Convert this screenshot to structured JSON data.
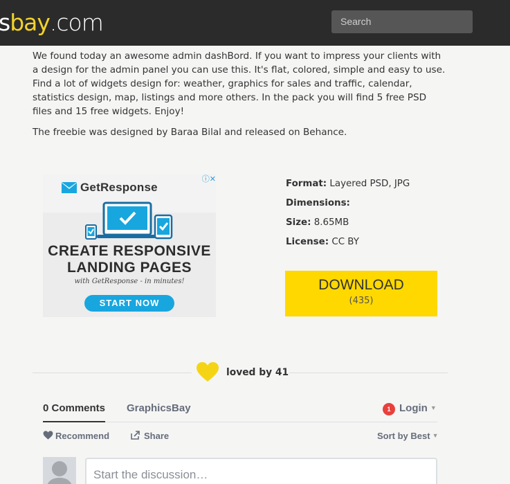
{
  "header": {
    "logo_part1": "s",
    "logo_part2": "bay",
    "logo_part3": ".com",
    "search_placeholder": "Search"
  },
  "article": {
    "paragraph1": "We found today an awesome admin dashBord. If you want to impress your clients with a design for the admin panel you can use this. It's flat, colored, simple and easy to use. Find a lot of widgets design for: weather, graphics for sales and traffic, calendar, statistics design, map, listings and more others. In the pack you will find 5 free PSD files and 15 free widgets. Enjoy!",
    "paragraph2": "The freebie was designed by Baraa Bilal and released on Behance."
  },
  "ad": {
    "brand": "GetResponse",
    "headline_line1": "CREATE RESPONSIVE",
    "headline_line2": "LANDING PAGES",
    "tagline": "with GetResponse - in minutes!",
    "cta": "START NOW",
    "adchoices": "ⓘ✕"
  },
  "meta": {
    "format_label": "Format:",
    "format_value": " Layered PSD, JPG",
    "dimensions_label": "Dimensions:",
    "dimensions_value": "",
    "size_label": "Size:",
    "size_value": " 8.65MB",
    "license_label": "License:",
    "license_value": " CC BY"
  },
  "download": {
    "label": "DOWNLOAD",
    "count": "(435)"
  },
  "loved": {
    "text": "loved by 41",
    "heart_color": "#f5d416"
  },
  "comments": {
    "tab_comments": "0 Comments",
    "tab_site": "GraphicsBay",
    "login_badge": "1",
    "login_label": "Login",
    "recommend_label": "Recommend",
    "share_label": "Share",
    "sort_label": "Sort by Best",
    "discussion_placeholder": "Start the discussion…"
  },
  "colors": {
    "accent_yellow": "#ffd800",
    "header_bg": "#2b2b2b",
    "cta_blue": "#18a6df",
    "badge_red": "#e8413c"
  }
}
